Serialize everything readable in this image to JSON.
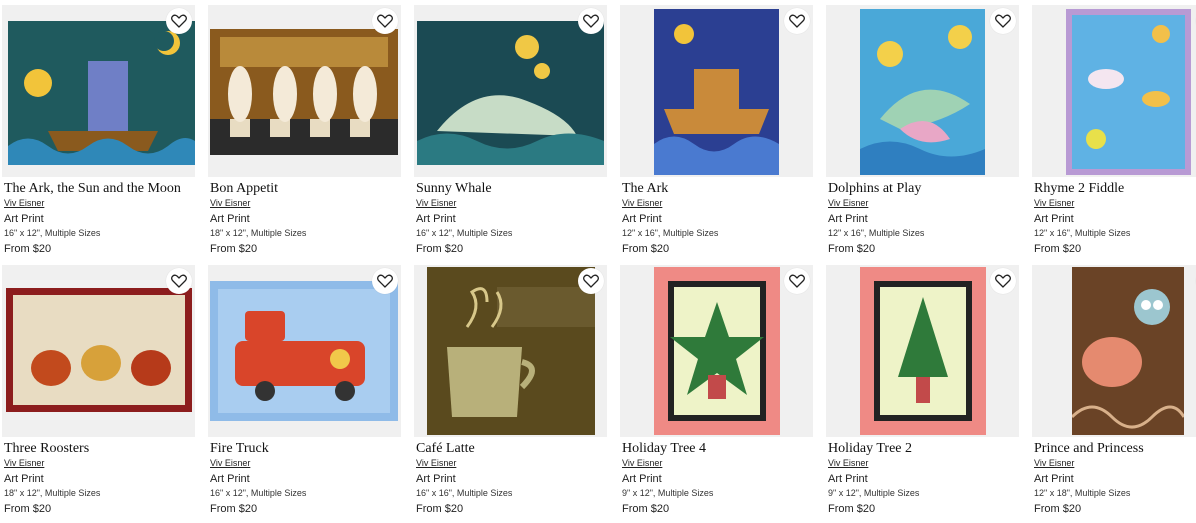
{
  "products": [
    {
      "title": "The Ark, the Sun and the Moon",
      "artist": "Viv Eisner",
      "type": "Art Print",
      "size": "16\" x 12\", Multiple Sizes",
      "price": "From $20",
      "art": {
        "bg": "#1f5a5e",
        "accent": "#f2c43a",
        "detail": "#6f7fc6"
      }
    },
    {
      "title": "Bon Appetit",
      "artist": "Viv Eisner",
      "type": "Art Print",
      "size": "18\" x 12\", Multiple Sizes",
      "price": "From $20",
      "art": {
        "bg": "#8a5a1e",
        "accent": "#f4ead8",
        "detail": "#2b2b2b"
      }
    },
    {
      "title": "Sunny Whale",
      "artist": "Viv Eisner",
      "type": "Art Print",
      "size": "16\" x 12\", Multiple Sizes",
      "price": "From $20",
      "art": {
        "bg": "#1b4a53",
        "accent": "#c7dcc6",
        "detail": "#f0c845"
      }
    },
    {
      "title": "The Ark",
      "artist": "Viv Eisner",
      "type": "Art Print",
      "size": "12\" x 16\", Multiple Sizes",
      "price": "From $20",
      "art": {
        "bg": "#2b3f92",
        "accent": "#c98a3a",
        "detail": "#4a7ad0"
      }
    },
    {
      "title": "Dolphins at Play",
      "artist": "Viv Eisner",
      "type": "Art Print",
      "size": "12\" x 16\", Multiple Sizes",
      "price": "From $20",
      "art": {
        "bg": "#4aa8d8",
        "accent": "#9fd2b4",
        "detail": "#f3d04a"
      }
    },
    {
      "title": "Rhyme 2 Fiddle",
      "artist": "Viv Eisner",
      "type": "Art Print",
      "size": "12\" x 16\", Multiple Sizes",
      "price": "From $20",
      "art": {
        "bg": "#5fb2e4",
        "accent": "#b89ad4",
        "detail": "#f2c04a"
      }
    },
    {
      "title": "Three Roosters",
      "artist": "Viv Eisner",
      "type": "Art Print",
      "size": "18\" x 12\", Multiple Sizes",
      "price": "From $20",
      "art": {
        "bg": "#8c1d1d",
        "accent": "#e8dcc2",
        "detail": "#c24a1d"
      }
    },
    {
      "title": "Fire Truck",
      "artist": "Viv Eisner",
      "type": "Art Print",
      "size": "16\" x 12\", Multiple Sizes",
      "price": "From $20",
      "art": {
        "bg": "#8fbbe8",
        "accent": "#d9452a",
        "detail": "#f1c84a"
      }
    },
    {
      "title": "Café Latte",
      "artist": "Viv Eisner",
      "type": "Art Print",
      "size": "16\" x 16\", Multiple Sizes",
      "price": "From $20",
      "art": {
        "bg": "#5a4a1e",
        "accent": "#b8b07a",
        "detail": "#d8c88a"
      }
    },
    {
      "title": "Holiday Tree 4",
      "artist": "Viv Eisner",
      "type": "Art Print",
      "size": "9\" x 12\", Multiple Sizes",
      "price": "From $20",
      "art": {
        "bg": "#ef8a85",
        "accent": "#eef3c8",
        "detail": "#2f7a3a"
      }
    },
    {
      "title": "Holiday Tree 2",
      "artist": "Viv Eisner",
      "type": "Art Print",
      "size": "9\" x 12\", Multiple Sizes",
      "price": "From $20",
      "art": {
        "bg": "#ef8a85",
        "accent": "#eef3c8",
        "detail": "#2f7a3a"
      }
    },
    {
      "title": "Prince and Princess",
      "artist": "Viv Eisner",
      "type": "Art Print",
      "size": "12\" x 18\", Multiple Sizes",
      "price": "From $20",
      "art": {
        "bg": "#6a4326",
        "accent": "#e58a6f",
        "detail": "#9cc6cf"
      }
    }
  ],
  "icons": {
    "favorite": "heart-outline-icon"
  }
}
